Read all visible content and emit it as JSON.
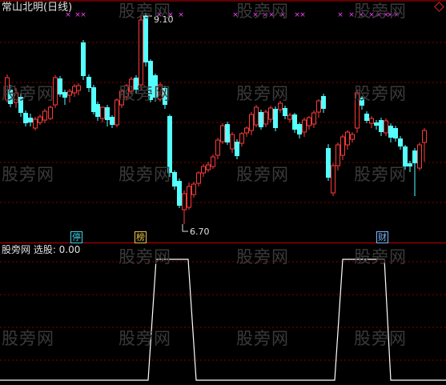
{
  "title": "常山北明(日线)",
  "indicator_label": "股旁网 选股: 0.00",
  "watermark": "股旁网",
  "price_high_label": "9.10",
  "price_low_label": "6.70",
  "event_tags": [
    {
      "text": "停",
      "color": "#3fd3e8"
    },
    {
      "text": "榜",
      "color": "#e8c34a"
    },
    {
      "text": "财",
      "color": "#7ab8ff"
    }
  ],
  "colors": {
    "up": "#ff3a3a",
    "down": "#54ffff",
    "grid": "#8a0000",
    "divider": "#c00000",
    "signal_line": "#ffffff",
    "marker": "#ff40ff"
  },
  "icons": {
    "corner": "red-diamond-icon",
    "marker": "magenta-x-icon"
  },
  "chart_data": {
    "type": "candlestick",
    "title": "常山北明(日线)",
    "price_range": [
      6.7,
      9.1
    ],
    "annotations": [
      "9.10",
      "6.70"
    ],
    "indicator": {
      "name": "选股",
      "value": 0.0,
      "pulses": [
        {
          "from_bar": 35,
          "to_bar": 45
        },
        {
          "from_bar": 80,
          "to_bar": 91
        }
      ]
    }
  }
}
